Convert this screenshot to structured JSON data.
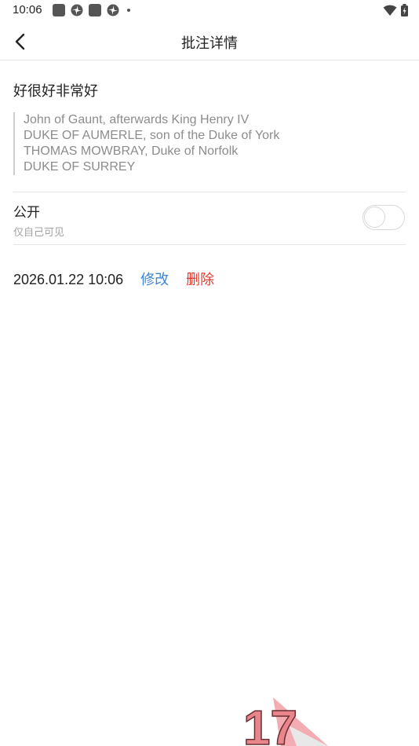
{
  "status_bar": {
    "time": "10:06"
  },
  "nav": {
    "title": "批注详情",
    "back_icon": "chevron-left-icon"
  },
  "note": {
    "title": "好很好非常好",
    "quote_lines": [
      "John of Gaunt, afterwards King Henry IV",
      "DUKE OF AUMERLE, son of the Duke of York",
      "THOMAS MOWBRAY, Duke of Norfolk",
      "DUKE OF SURREY"
    ]
  },
  "visibility": {
    "label": "公开",
    "sub_label": "仅自己可见",
    "is_public": false
  },
  "meta": {
    "timestamp": "2026.01.22 10:06",
    "edit_label": "修改",
    "delete_label": "删除"
  },
  "colors": {
    "edit": "#3d86d6",
    "delete": "#e03a2f",
    "divider": "#e6e6e6",
    "quote_text": "#8c8c8c"
  },
  "logo": {
    "text": "17"
  }
}
